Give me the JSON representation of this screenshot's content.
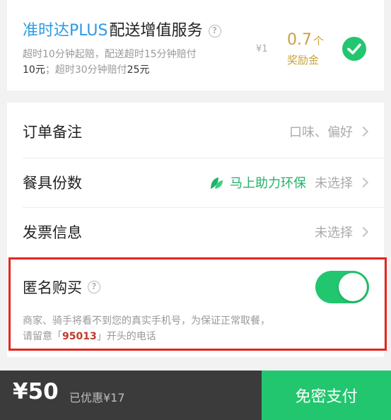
{
  "plus_service": {
    "brand": "准时达PLUS",
    "title_rest": "配送增值服务",
    "desc_line1_a": "超时10分钟起赔，配送超时15分钟赔付",
    "desc_line2_amount1": "10元",
    "desc_line2_mid": "；超时30分钟赔付",
    "desc_line2_amount2": "25元",
    "original_price": "¥1",
    "reward_amount": "0.7",
    "reward_unit": "个",
    "reward_label": "奖励金"
  },
  "options": {
    "remark": {
      "label": "订单备注",
      "value": "口味、偏好"
    },
    "tableware": {
      "label": "餐具份数",
      "eco_text": "马上助力环保",
      "value": "未选择"
    },
    "invoice": {
      "label": "发票信息",
      "value": "未选择"
    }
  },
  "anonymous": {
    "label": "匿名购买",
    "desc_line1": "商家、骑手将看不到您的真实手机号，为保证正常取餐，",
    "desc_line2_a": "请留意「",
    "phone_prefix": "95013",
    "desc_line2_b": "」开头的电话",
    "enabled": true
  },
  "footer": {
    "price": "¥50",
    "discount": "已优惠¥17",
    "pay_label": "免密支付"
  },
  "colors": {
    "brand_blue": "#2a9be6",
    "accent_green": "#22c66f",
    "reward_gold": "#c8a23f",
    "highlight_red": "#e5251c"
  }
}
